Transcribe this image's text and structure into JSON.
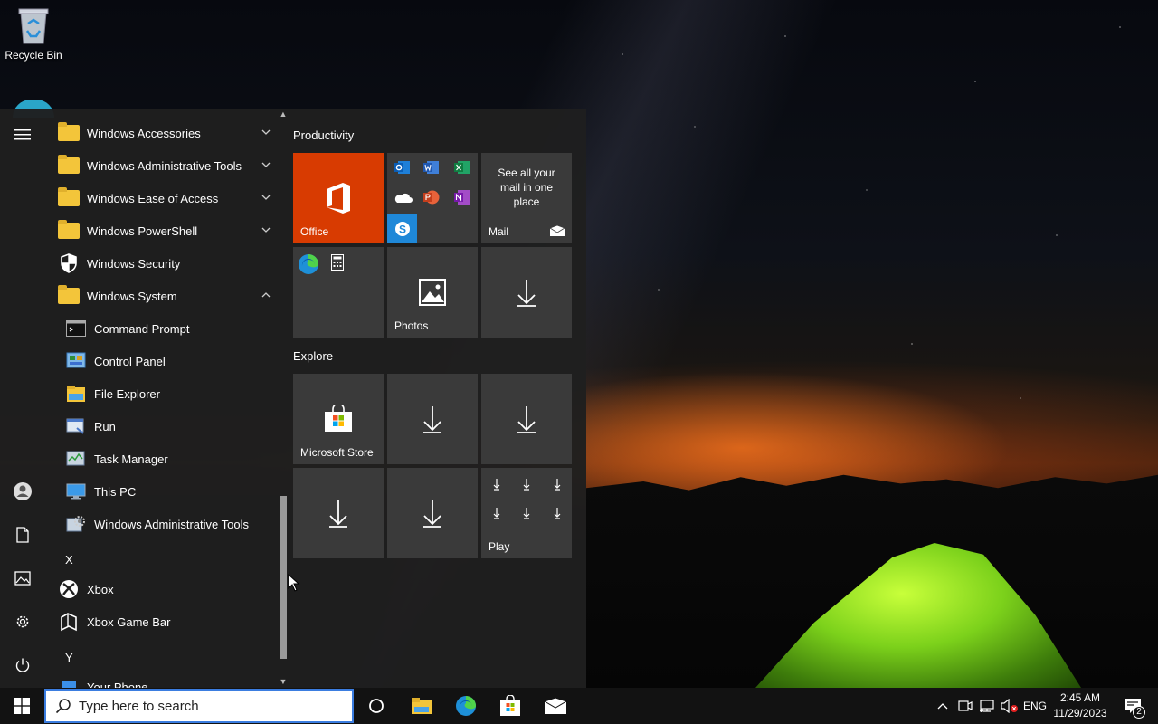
{
  "desktop": {
    "recycle_bin_label": "Recycle Bin"
  },
  "rail": {
    "icons": [
      "hamburger-icon",
      "user-icon",
      "document-icon",
      "pictures-icon",
      "settings-icon",
      "power-icon"
    ]
  },
  "applist": {
    "folders": [
      {
        "label": "Windows Accessories"
      },
      {
        "label": "Windows Administrative Tools"
      },
      {
        "label": "Windows Ease of Access"
      },
      {
        "label": "Windows PowerShell"
      }
    ],
    "security_label": "Windows Security",
    "system_label": "Windows System",
    "system_items": [
      {
        "label": "Command Prompt"
      },
      {
        "label": "Control Panel"
      },
      {
        "label": "File Explorer"
      },
      {
        "label": "Run"
      },
      {
        "label": "Task Manager"
      },
      {
        "label": "This PC"
      },
      {
        "label": "Windows Administrative Tools"
      }
    ],
    "letter_x": "X",
    "xbox_label": "Xbox",
    "xbox_game_bar_label": "Xbox Game Bar",
    "letter_y": "Y",
    "your_phone_label": "Your Phone"
  },
  "tiles": {
    "productivity_title": "Productivity",
    "office_label": "Office",
    "mail_text": "See all your mail in one place",
    "mail_label": "Mail",
    "photos_label": "Photos",
    "explore_title": "Explore",
    "store_label": "Microsoft Store",
    "play_label": "Play"
  },
  "taskbar": {
    "search_placeholder": "Type here to search",
    "language": "ENG",
    "time": "2:45 AM",
    "date": "11/29/2023",
    "notification_count": "2"
  },
  "colors": {
    "accent": "#3b7de0",
    "office_tile": "#d83b01",
    "tile_bg": "#3a3a3a",
    "start_bg": "#1f1f1f",
    "taskbar_bg": "#121212"
  }
}
